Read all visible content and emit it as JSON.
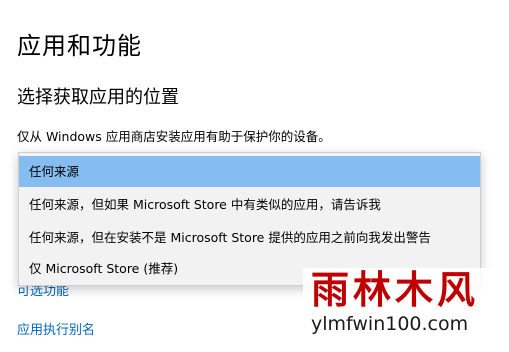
{
  "page": {
    "title": "应用和功能",
    "section_heading": "选择获取应用的位置",
    "description": "仅从 Windows 应用商店安装应用有助于保护你的设备。"
  },
  "dropdown": {
    "selected_index": 0,
    "options": [
      {
        "label": "任何来源"
      },
      {
        "label": "任何来源，但如果 Microsoft Store 中有类似的应用，请告诉我"
      },
      {
        "label": "任何来源，但在安装不是 Microsoft Store 提供的应用之前向我发出警告"
      },
      {
        "label": "仅 Microsoft Store (推荐)"
      }
    ]
  },
  "links": {
    "optional_features": "可选功能",
    "app_execution_aliases": "应用执行别名"
  },
  "watermark": {
    "chinese": "雨林木风",
    "url": "ylmfwin100.com"
  },
  "colors": {
    "selected_option_bg": "#86bdf0",
    "link": "#0067c0",
    "watermark_red": "#c00000"
  }
}
